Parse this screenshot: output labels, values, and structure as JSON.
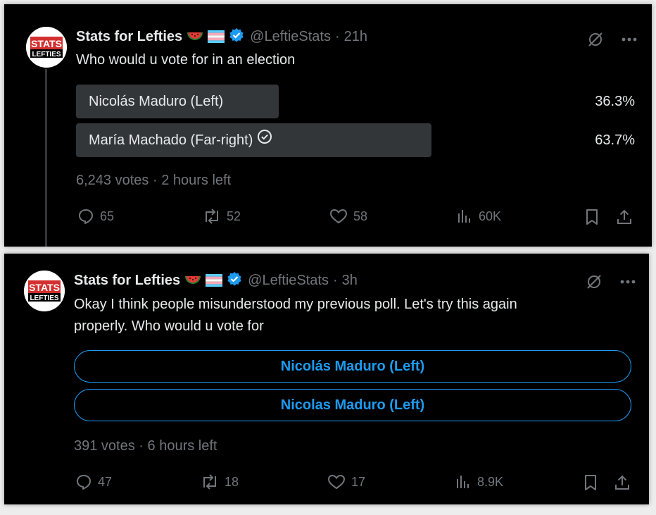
{
  "tweets": [
    {
      "author": {
        "name": "Stats for Lefties",
        "handle": "@LeftieStats",
        "time": "21h",
        "avatar_text_top": "STATS",
        "avatar_text_bottom": "LEFTIES"
      },
      "text": "Who would u vote for in an election",
      "poll": {
        "state": "results",
        "options": [
          {
            "label": "Nicolás Maduro (Left)",
            "percent": "36.3%",
            "fraction": 0.363,
            "winner": false
          },
          {
            "label": "María Machado (Far-right)",
            "percent": "63.7%",
            "fraction": 0.637,
            "winner": true
          }
        ],
        "votes": "6,243 votes",
        "time_left": "2 hours left"
      },
      "actions": {
        "replies": "65",
        "reposts": "52",
        "likes": "58",
        "views": "60K"
      }
    },
    {
      "author": {
        "name": "Stats for Lefties",
        "handle": "@LeftieStats",
        "time": "3h",
        "avatar_text_top": "STATS",
        "avatar_text_bottom": "LEFTIES"
      },
      "text_line1": "Okay I think people misunderstood my previous poll. Let's try this again",
      "text_line2": "properly. Who would u vote for",
      "poll": {
        "state": "voting",
        "options": [
          {
            "label": "Nicolás Maduro (Left)"
          },
          {
            "label": "Nicolas Maduro (Left)"
          }
        ],
        "votes": "391 votes",
        "time_left": "6 hours left"
      },
      "actions": {
        "replies": "47",
        "reposts": "18",
        "likes": "17",
        "views": "8.9K"
      }
    }
  ],
  "icons": {
    "emoji": [
      "watermelon-emoji",
      "transgender-flag-emoji"
    ],
    "verified": "verified-badge-icon",
    "top": [
      "grok-slash-icon",
      "more-icon"
    ],
    "actions": [
      "reply-icon",
      "repost-icon",
      "like-icon",
      "views-icon",
      "bookmark-icon",
      "share-icon"
    ]
  },
  "colors": {
    "background": "#000000",
    "text": "#e7e9ea",
    "muted": "#71767b",
    "accent": "#1d9bf0",
    "poll_bar": "#333639"
  }
}
